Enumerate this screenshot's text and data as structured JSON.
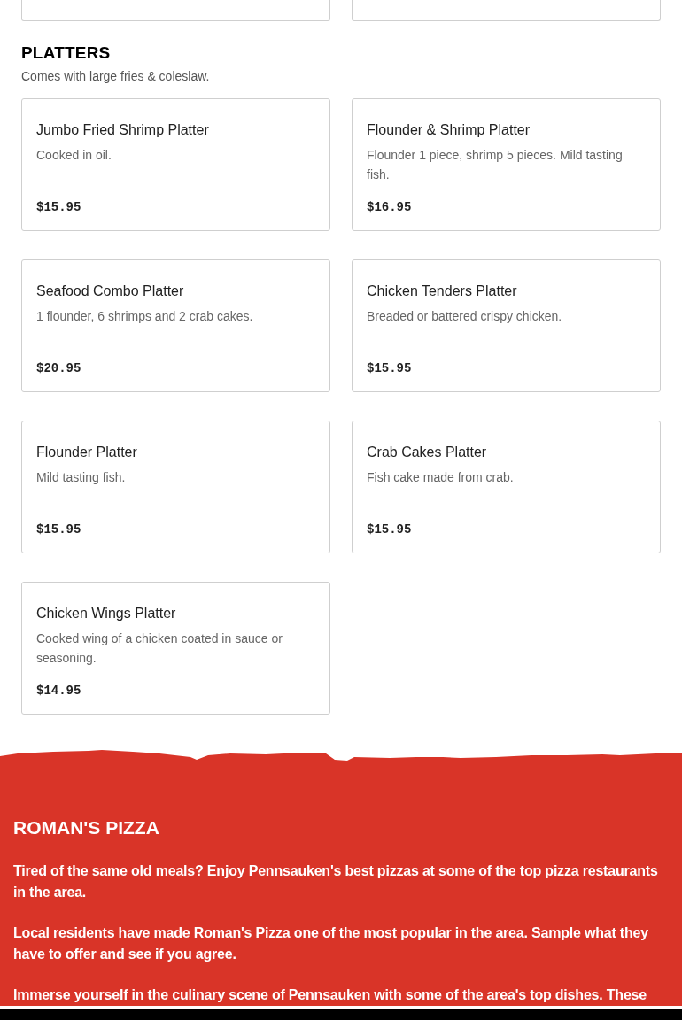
{
  "platters": {
    "title": "PLATTERS",
    "subtitle": "Comes with large fries & coleslaw.",
    "items": [
      {
        "name": "Jumbo Fried Shrimp Platter",
        "description": "Cooked in oil.",
        "price": "$15.95"
      },
      {
        "name": "Flounder & Shrimp Platter",
        "description": "Flounder 1 piece, shrimp 5 pieces. Mild tasting fish.",
        "price": "$16.95"
      },
      {
        "name": "Seafood Combo Platter",
        "description": "1 flounder, 6 shrimps and 2 crab cakes.",
        "price": "$20.95"
      },
      {
        "name": "Chicken Tenders Platter",
        "description": "Breaded or battered crispy chicken.",
        "price": "$15.95"
      },
      {
        "name": "Flounder Platter",
        "description": "Mild tasting fish.",
        "price": "$15.95"
      },
      {
        "name": "Crab Cakes Platter",
        "description": "Fish cake made from crab.",
        "price": "$15.95"
      },
      {
        "name": "Chicken Wings Platter",
        "description": "Cooked wing of a chicken coated in sauce or seasoning.",
        "price": "$14.95"
      }
    ]
  },
  "about": {
    "title": "ROMAN'S PIZZA",
    "paragraphs": [
      "Tired of the same old meals? Enjoy Pennsauken's best pizzas at some of the top pizza restaurants in the area.",
      "Local residents have made Roman's Pizza one of the most popular in the area. Sample what they have to offer and see if you agree.",
      "Immerse yourself in the culinary scene of Pennsauken with some of the area's top dishes. These"
    ]
  }
}
